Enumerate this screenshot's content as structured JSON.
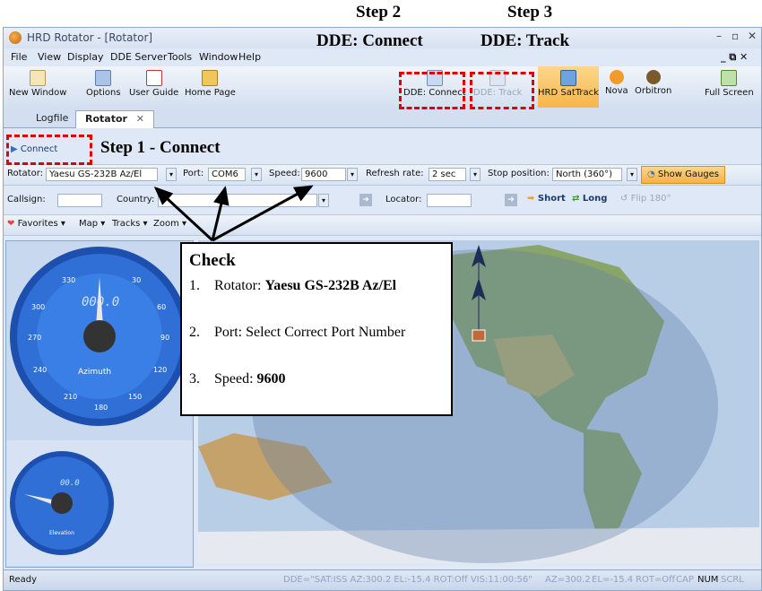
{
  "annotations": {
    "step2_title": "Step 2",
    "step2_sub": "DDE: Connect",
    "step3_title": "Step 3",
    "step3_sub": "DDE: Track",
    "step1": "Step 1 - Connect",
    "check_title": "Check",
    "check_items": [
      {
        "num": "1.",
        "prefix": "Rotator: ",
        "bold": "Yaesu GS-232B Az/El"
      },
      {
        "num": "2.",
        "prefix": "Port: Select Correct Port Number",
        "bold": ""
      },
      {
        "num": "3.",
        "prefix": "Speed: ",
        "bold": "9600"
      }
    ]
  },
  "window": {
    "title": "HRD Rotator - [Rotator]",
    "controls": {
      "minimize": "–",
      "restore": "▫",
      "close": "✕"
    },
    "menu": [
      "File",
      "View",
      "Display",
      "DDE Server",
      "Tools",
      "Window",
      "Help"
    ],
    "menu_right": "_ ⧉ ✕"
  },
  "toolbar": {
    "new_window": "New Window",
    "options": "Options",
    "user_guide": "User Guide",
    "home_page": "Home Page",
    "dde_connect": "DDE: Connect",
    "dde_track": "DDE: Track",
    "hrd_sattrack": "HRD SatTrack",
    "nova": "Nova",
    "orbitron": "Orbitron",
    "full_screen": "Full Screen"
  },
  "tabs": [
    {
      "label": "Logfile"
    },
    {
      "label": "Rotator",
      "close": "✕"
    }
  ],
  "connect_button": "Connect",
  "settings": {
    "rotator_label": "Rotator:",
    "rotator_value": "Yaesu GS-232B Az/El",
    "port_label": "Port:",
    "port_value": "COM6",
    "speed_label": "Speed:",
    "speed_value": "9600",
    "refresh_label": "Refresh rate:",
    "refresh_value": "2 sec",
    "stop_label": "Stop position:",
    "stop_value": "North (360°)",
    "show_gauges": "Show Gauges"
  },
  "locator_row": {
    "callsign_label": "Callsign:",
    "country_label": "Country:",
    "locator_label": "Locator:",
    "short": "Short",
    "long": "Long",
    "flip": "Flip 180°"
  },
  "map_toolbar": {
    "favorites": "Favorites ▾",
    "map": "Map ▾",
    "tracks": "Tracks ▾",
    "zoom": "Zoom ▾"
  },
  "azimuth_gauge": {
    "label": "Azimuth",
    "readout": "000.0",
    "ticks": [
      "330",
      "30",
      "300",
      "60",
      "270",
      "90",
      "240",
      "120",
      "210",
      "150",
      "180"
    ]
  },
  "elevation_gauge": {
    "label": "Elevation",
    "readout": "00.0"
  },
  "status": {
    "ready": "Ready",
    "dde_info": "DDE=\"SAT:ISS AZ:300.2 EL:-15.4 ROT:Off VIS:11:00:56\"",
    "az": "AZ=300.2",
    "el": "EL=-15.4",
    "rot": "ROT=Off",
    "cap": "CAP",
    "num": "NUM",
    "scrl": "SCRL"
  },
  "colors": {
    "annotation_red": "#e00000",
    "gauge_blue": "#2f6fd6",
    "sattrack_orange": "#f7b54a",
    "show_gauges_orange": "#f5b048"
  }
}
